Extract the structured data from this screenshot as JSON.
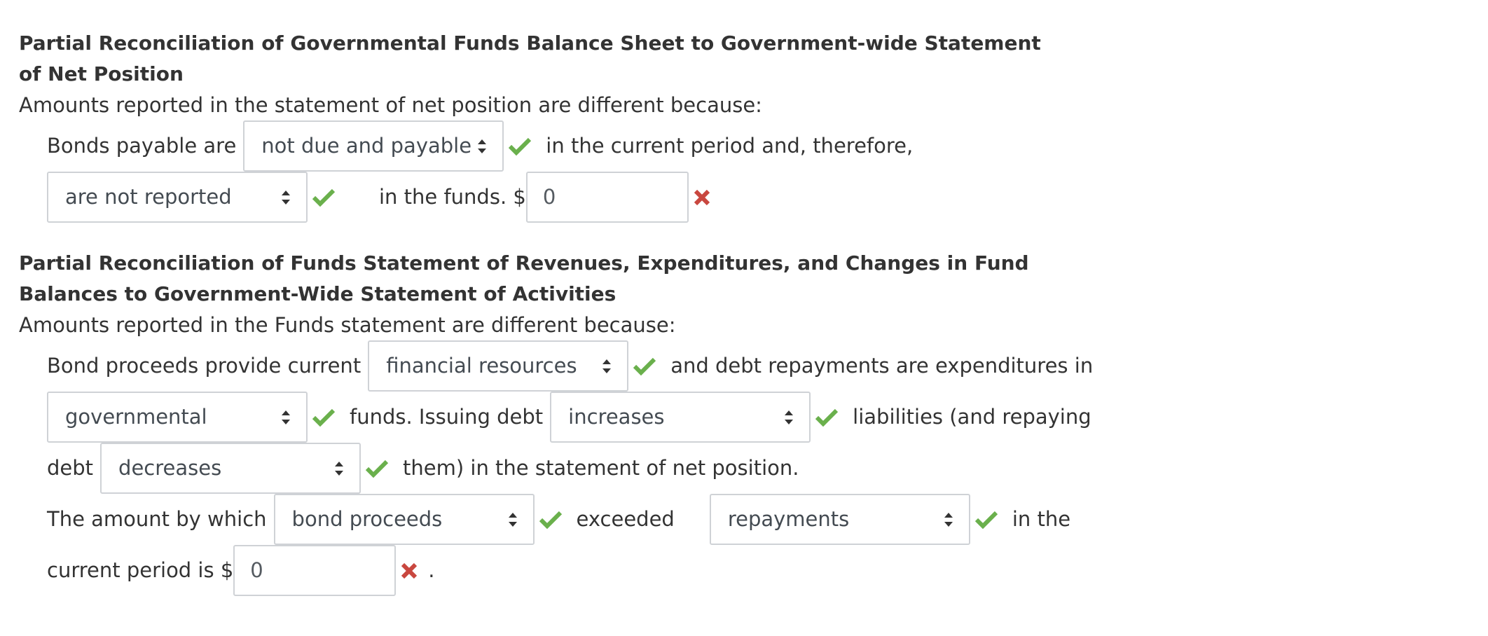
{
  "section1": {
    "heading_line1": "Partial Reconciliation of Governmental Funds Balance Sheet to Government-wide Statement",
    "heading_line2": "of Net Position",
    "intro": "Amounts reported in the statement of net position are different because:",
    "text_bonds_payable_are": "Bonds payable are",
    "select_due": "not due and payable",
    "text_current_period": "in the current period and, therefore,",
    "select_reported": "are not reported",
    "text_in_funds": "in the funds. $",
    "amount_value": "0"
  },
  "section2": {
    "heading_line1": "Partial Reconciliation of Funds Statement of Revenues, Expenditures, and Changes in Fund",
    "heading_line2": "Balances to Government-Wide Statement of Activities",
    "intro": "Amounts reported in the Funds statement are different because:",
    "text_bond_proceeds": "Bond proceeds provide current",
    "select_resources": "financial resources",
    "text_debt_repayments": "and debt repayments are expenditures in",
    "select_fund_type": "governmental",
    "text_issuing_debt": "funds. Issuing debt",
    "select_issuing": "increases",
    "text_liabilities": "liabilities (and repaying",
    "text_debt": "debt",
    "select_repaying": "decreases",
    "text_them": "them) in the statement of net position.",
    "text_amount_by_which": "The amount by which",
    "select_first": "bond proceeds",
    "text_exceeded": "exceeded",
    "select_second": "repayments",
    "text_in_the": "in the",
    "text_current_period_is": "current period is $",
    "amount_value": "0",
    "text_period": "."
  },
  "colors": {
    "correct": "#6ab04c",
    "incorrect": "#c9473f",
    "border": "#cfd2d6",
    "text": "#333333"
  },
  "icons": {
    "correct": "check-icon",
    "incorrect": "cross-icon",
    "select": "sort-arrows-icon"
  }
}
